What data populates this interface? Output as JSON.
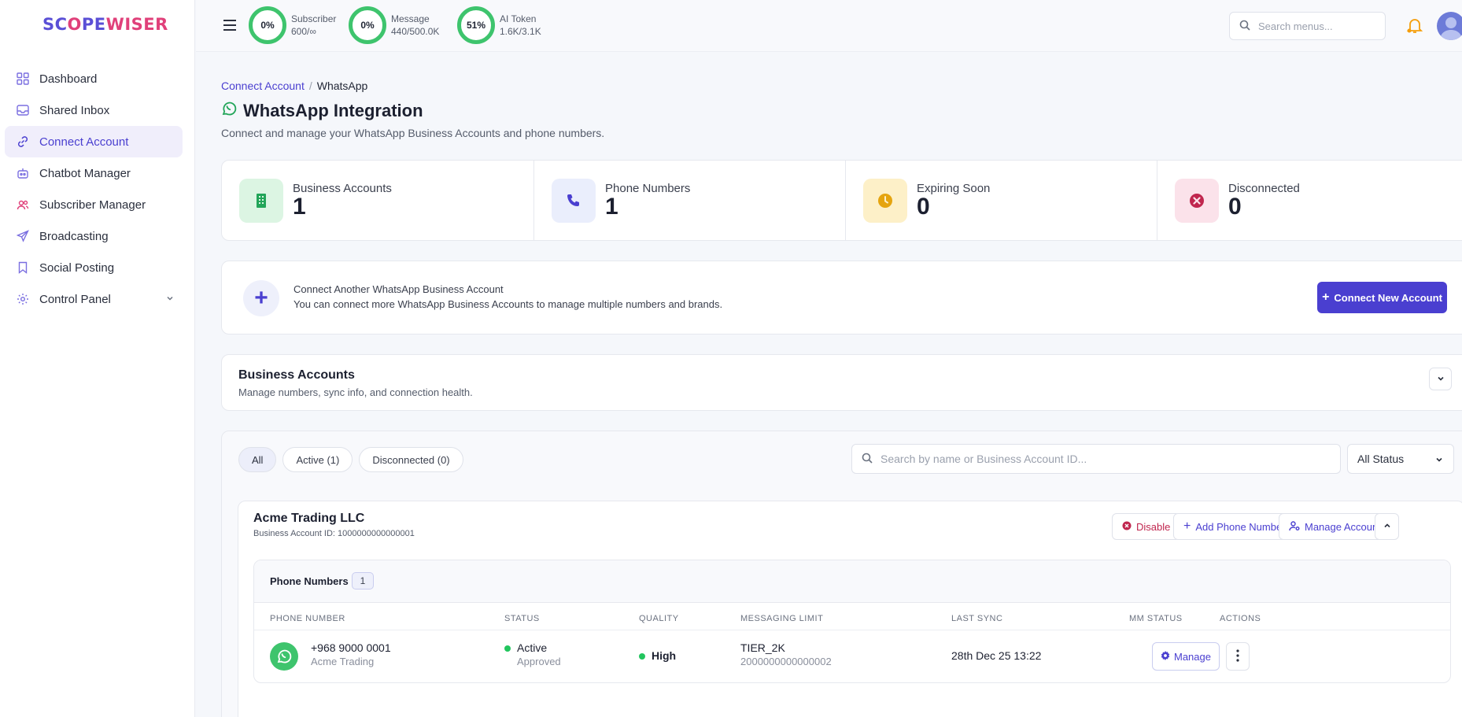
{
  "app": {
    "logo_a": "SC",
    "logo_o": "O",
    "logo_b": "PE",
    "logo_c": "WISER"
  },
  "sidebar": {
    "items": [
      {
        "label": "Dashboard",
        "icon": "grid-icon"
      },
      {
        "label": "Shared Inbox",
        "icon": "inbox-icon"
      },
      {
        "label": "Connect Account",
        "icon": "link-icon",
        "active": true
      },
      {
        "label": "Chatbot Manager",
        "icon": "bot-icon"
      },
      {
        "label": "Subscriber Manager",
        "icon": "users-icon"
      },
      {
        "label": "Broadcasting",
        "icon": "send-icon"
      },
      {
        "label": "Social Posting",
        "icon": "bookmark-icon"
      },
      {
        "label": "Control Panel",
        "icon": "gear-icon"
      }
    ]
  },
  "topbar": {
    "meters": [
      {
        "pct": "0%",
        "label": "Subscriber",
        "value": "600/∞"
      },
      {
        "pct": "0%",
        "label": "Message",
        "value": "440/500.0K"
      },
      {
        "pct": "51%",
        "label": "AI Token",
        "value": "1.6K/3.1K"
      }
    ],
    "search_placeholder": "Search menus..."
  },
  "breadcrumb": {
    "parent": "Connect Account",
    "sep": "/",
    "current": "WhatsApp"
  },
  "page": {
    "title": "WhatsApp Integration",
    "subtitle": "Connect and manage your WhatsApp Business Accounts and phone numbers."
  },
  "stats": [
    {
      "label": "Business Accounts",
      "value": "1",
      "bg": "#dcf5e3",
      "fg": "#22a559"
    },
    {
      "label": "Phone Numbers",
      "value": "1",
      "bg": "#eaeefc",
      "fg": "#4a3fd0"
    },
    {
      "label": "Expiring Soon",
      "value": "0",
      "bg": "#fdf0c8",
      "fg": "#e5a40f"
    },
    {
      "label": "Disconnected",
      "value": "0",
      "bg": "#fbe2ea",
      "fg": "#c0264e"
    }
  ],
  "connect": {
    "title": "Connect Another WhatsApp Business Account",
    "desc": "You can connect more WhatsApp Business Accounts to manage multiple numbers and brands.",
    "button": "Connect New Account"
  },
  "business_accounts": {
    "title": "Business Accounts",
    "subtitle": "Manage numbers, sync info, and connection health."
  },
  "filters": {
    "tabs": [
      "All",
      "Active (1)",
      "Disconnected (0)"
    ],
    "search_placeholder": "Search by name or Business Account ID...",
    "status_select": "All Status"
  },
  "account": {
    "name": "Acme Trading LLC",
    "id_text": "Business Account ID: 1000000000000001",
    "buttons": {
      "disable": "Disable",
      "add_phone": "Add Phone Number",
      "manage": "Manage Account"
    }
  },
  "phone_table": {
    "section_label": "Phone Numbers",
    "count": "1",
    "columns": [
      "PHONE NUMBER",
      "STATUS",
      "QUALITY",
      "MESSAGING LIMIT",
      "LAST SYNC",
      "MM STATUS",
      "ACTIONS"
    ],
    "rows": [
      {
        "number": "+968 9000 0001",
        "name": "Acme Trading",
        "status": "Active",
        "status_sub": "Approved",
        "quality": "High",
        "limit": "TIER_2K",
        "limit_sub": "2000000000000002",
        "last_sync": "28th Dec 25 13:22",
        "mm_status": "",
        "action": "Manage"
      }
    ]
  }
}
